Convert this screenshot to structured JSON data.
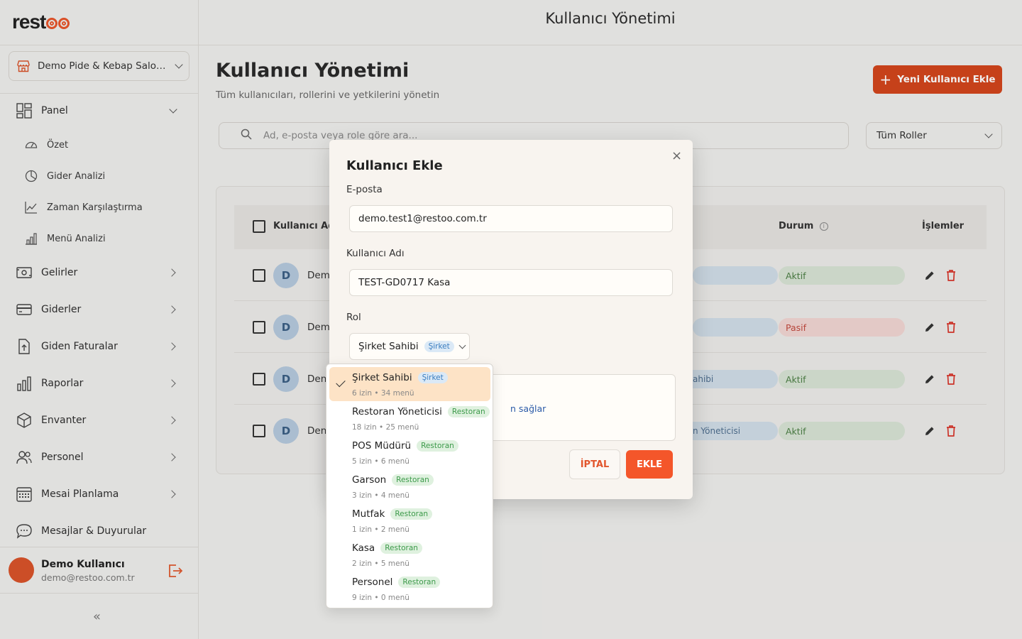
{
  "sidebar": {
    "logo": "restoo",
    "org": "Demo Pide & Kebap Salon...",
    "nav": [
      {
        "label": "Panel",
        "icon": "dashboard-icon"
      },
      {
        "label": "Gelirler",
        "icon": "money-icon"
      },
      {
        "label": "Giderler",
        "icon": "card-icon"
      },
      {
        "label": "Giden Faturalar",
        "icon": "invoice-icon"
      },
      {
        "label": "Raporlar",
        "icon": "chart-icon"
      },
      {
        "label": "Envanter",
        "icon": "box-icon"
      },
      {
        "label": "Personel",
        "icon": "people-icon"
      },
      {
        "label": "Mesai Planlama",
        "icon": "calendar-icon"
      },
      {
        "label": "Mesajlar & Duyurular",
        "icon": "chat-icon"
      }
    ],
    "sub": [
      {
        "label": "Özet",
        "icon": "gauge-icon"
      },
      {
        "label": "Gider Analizi",
        "icon": "pie-icon"
      },
      {
        "label": "Zaman Karşılaştırma",
        "icon": "trend-icon"
      },
      {
        "label": "Menü Analizi",
        "icon": "bars-icon"
      }
    ],
    "user": {
      "name": "Demo Kullanıcı",
      "email": "demo@restoo.com.tr"
    },
    "collapse": "«"
  },
  "header": {
    "title": "Kullanıcı Yönetimi"
  },
  "page": {
    "title": "Kullanıcı Yönetimi",
    "subtitle": "Tüm kullanıcıları, rollerini ve yetkilerini yönetin",
    "add_button": "Yeni Kullanıcı Ekle",
    "search_placeholder": "Ad, e-posta veya role göre ara...",
    "role_filter": "Tüm Roller"
  },
  "table": {
    "columns": {
      "name": "Kullanıcı Adı",
      "status": "Durum",
      "actions": "İşlemler"
    },
    "rows": [
      {
        "initial": "D",
        "name": "Dem",
        "role": "",
        "status": "Aktif",
        "status_color": "#4c7f44"
      },
      {
        "initial": "D",
        "name": "Dem",
        "role": "",
        "status": "Pasif",
        "status_color": "#c24a3f"
      },
      {
        "initial": "D",
        "name": "Den",
        "role": "ahibi",
        "status": "Aktif",
        "status_color": "#4c7f44"
      },
      {
        "initial": "D",
        "name": "Den",
        "role": "n Yöneticisi",
        "status": "Aktif",
        "status_color": "#4c7f44"
      }
    ]
  },
  "modal": {
    "title": "Kullanıcı Ekle",
    "email_label": "E-posta",
    "email_value": "demo.test1@restoo.com.tr",
    "username_label": "Kullanıcı Adı",
    "username_value": "TEST-GD0717 Kasa",
    "role_label": "Rol",
    "role_value": "Şirket Sahibi",
    "role_tag": "Şirket",
    "info_link": "n sağlar",
    "cancel": "İPTAL",
    "submit": "EKLE",
    "close": "×"
  },
  "dropdown": {
    "options": [
      {
        "name": "Şirket Sahibi",
        "tag": "Şirket",
        "tag_type": "blue",
        "meta": "6 izin • 34 menü",
        "selected": true
      },
      {
        "name": "Restoran Yöneticisi",
        "tag": "Restoran",
        "tag_type": "green",
        "meta": "18 izin • 25 menü",
        "selected": false
      },
      {
        "name": "POS Müdürü",
        "tag": "Restoran",
        "tag_type": "green",
        "meta": "5 izin • 6 menü",
        "selected": false
      },
      {
        "name": "Garson",
        "tag": "Restoran",
        "tag_type": "green",
        "meta": "3 izin • 4 menü",
        "selected": false
      },
      {
        "name": "Mutfak",
        "tag": "Restoran",
        "tag_type": "green",
        "meta": "1 izin • 2 menü",
        "selected": false
      },
      {
        "name": "Kasa",
        "tag": "Restoran",
        "tag_type": "green",
        "meta": "2 izin • 5 menü",
        "selected": false
      },
      {
        "name": "Personel",
        "tag": "Restoran",
        "tag_type": "green",
        "meta": "9 izin • 0 menü",
        "selected": false
      }
    ]
  },
  "colors": {
    "accent": "#d3461c",
    "accent_light": "#f4562a",
    "selected_bg": "#fde3c6"
  }
}
